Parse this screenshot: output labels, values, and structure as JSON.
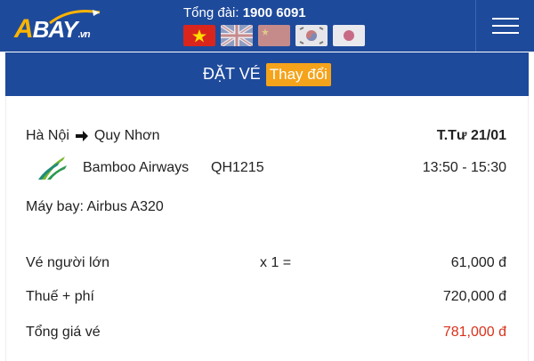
{
  "header": {
    "logo": {
      "main": "BAY",
      "prefix": "A",
      "suffix": ".vn"
    },
    "hotline_label": "Tổng đài:",
    "hotline_number": "1900 6091",
    "languages": [
      "vietnamese-flag",
      "uk-flag",
      "china-flag",
      "korea-flag",
      "japan-flag"
    ],
    "menu_icon": "hamburger-menu-icon"
  },
  "subbar": {
    "title": "ĐẶT VÉ",
    "change_label": "Thay đổi"
  },
  "flight": {
    "from": "Hà Nội",
    "to": "Quy Nhơn",
    "date": "T.Tư  21/01",
    "airline": "Bamboo Airways",
    "flight_no": "QH1215",
    "times": "13:50 - 15:30",
    "aircraft": "Máy bay: Airbus A320"
  },
  "pricing": {
    "adult_label": "Vé người lớn",
    "adult_qty": "x 1 =",
    "adult_price": "61,000 đ",
    "tax_label": "Thuế + phí",
    "tax_price": "720,000 đ",
    "total_label": "Tổng giá vé",
    "total_price": "781,000 đ"
  },
  "colors": {
    "primary": "#1e4a9b",
    "accent": "#f4a31a",
    "total": "#d9321c"
  }
}
